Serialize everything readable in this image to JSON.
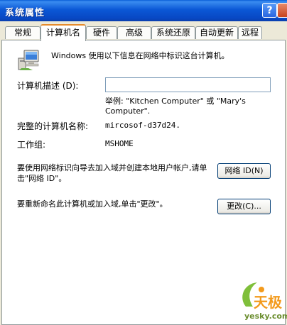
{
  "window": {
    "title": "系统属性",
    "help_label": "?",
    "close_label": "×"
  },
  "tabs": [
    {
      "label": "常规",
      "active": false
    },
    {
      "label": "计算机名",
      "active": true
    },
    {
      "label": "硬件",
      "active": false
    },
    {
      "label": "高级",
      "active": false
    },
    {
      "label": "系统还原",
      "active": false
    },
    {
      "label": "自动更新",
      "active": false
    },
    {
      "label": "远程",
      "active": false
    }
  ],
  "computer_name_tab": {
    "intro_text": "Windows 使用以下信息在网络中标识这台计算机。",
    "description_label": "计算机描述 (D):",
    "description_value": "",
    "example_text": "举例: \"Kitchen Computer\" 或 \"Mary's Computer\".",
    "full_name_label": "完整的计算机名称:",
    "full_name_value": "mircosof-d37d24.",
    "workgroup_label": "工作组:",
    "workgroup_value": "MSHOME",
    "network_id_text": "要使用网络标识向导去加入域并创建本地用户帐户,请单击\"网络 ID\"。",
    "network_id_button": "网络 ID(N)",
    "rename_text": "要重新命名此计算机或加入域,单击\"更改\"。",
    "change_button": "更改(C)..."
  },
  "watermark": {
    "brand": "天极",
    "url": "yesky.com"
  }
}
